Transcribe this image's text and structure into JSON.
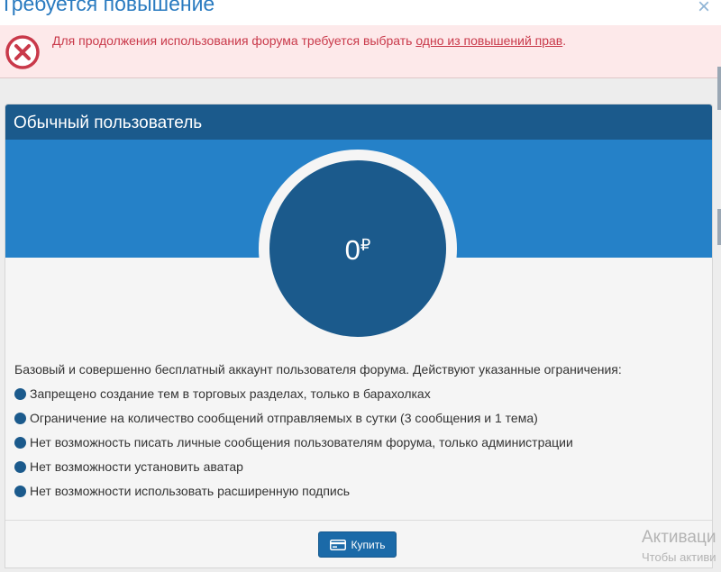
{
  "dialog": {
    "title": "Требуется повышение",
    "close_symbol": "×"
  },
  "alert": {
    "icon": "error-circle-x-icon",
    "text": "Для продолжения использования форума требуется выбрать ",
    "link_text": "одно из повышений прав",
    "suffix": ".",
    "color": "#c9394a"
  },
  "plan": {
    "title": "Обычный пользователь",
    "price": "0",
    "currency": "₽",
    "description": "Базовый и совершенно бесплатный аккаунт пользователя форума. Действуют указанные ограничения:",
    "features": [
      "Запрещено создание тем в торговых разделах, только в барахолках",
      "Ограничение на количество сообщений отправляемых в сутки (3 сообщения и 1 тема)",
      "Нет возможность писать личные сообщения пользователям форума, только администрации",
      "Нет возможности установить аватар",
      "Нет возможности использовать расширенную подпись"
    ],
    "buy_label": "Купить",
    "buy_icon": "credit-card-icon",
    "colors": {
      "header": "#1b5a8c",
      "band": "#2581c8",
      "button": "#1b6aa8"
    }
  },
  "watermark": {
    "title": "Активаци",
    "subtitle": "Чтобы активи"
  }
}
